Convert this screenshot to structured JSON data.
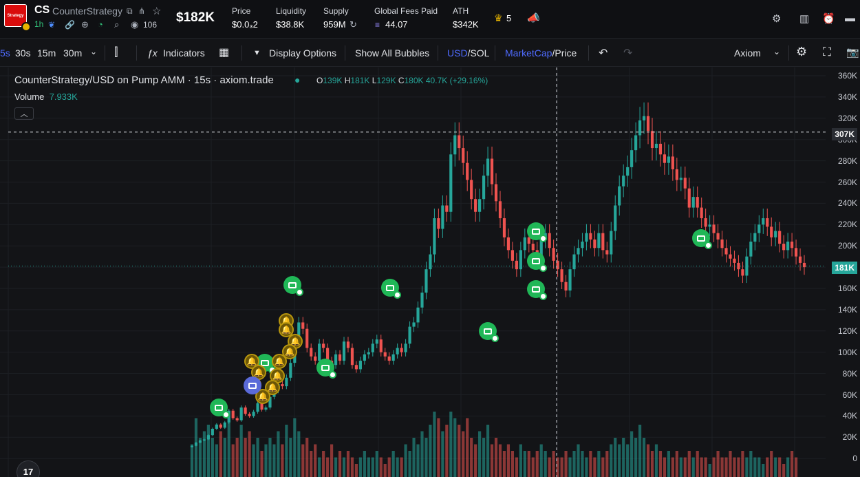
{
  "header": {
    "logo_text": "Strategy",
    "ticker": "CS",
    "name": "CounterStrategy",
    "timeframe": "1h",
    "watchers": "106",
    "market_cap": "$182K",
    "stats": [
      {
        "label": "Price",
        "value": "$0.0₃2"
      },
      {
        "label": "Liquidity",
        "value": "$38.8K"
      },
      {
        "label": "Supply",
        "value": "959M"
      },
      {
        "label": "Global Fees Paid",
        "value": "44.07"
      },
      {
        "label": "ATH",
        "value": "$342K"
      }
    ],
    "crown_count": "5"
  },
  "toolbar": {
    "intervals": [
      "5s",
      "30s",
      "15m",
      "30m"
    ],
    "indicators": "Indicators",
    "display_options": "Display Options",
    "show_bubbles": "Show All Bubbles",
    "usd": "USD",
    "sol": "SOL",
    "slash": "/",
    "marketcap": "MarketCap",
    "price": "Price",
    "layout": "Axiom"
  },
  "legend": {
    "title": "CounterStrategy/USD on Pump AMM · 15s · axiom.trade",
    "o_label": "O",
    "o": "139K",
    "h_label": "H",
    "h": "181K",
    "l_label": "L",
    "l": "129K",
    "c_label": "C",
    "c": "180K",
    "change": "40.7K (+29.16%)",
    "volume_label": "Volume",
    "volume": "7.933K"
  },
  "yaxis": {
    "labels": [
      "360K",
      "340K",
      "320K",
      "300K",
      "280K",
      "260K",
      "240K",
      "220K",
      "200K",
      "180K",
      "160K",
      "140K",
      "120K",
      "100K",
      "80K",
      "60K",
      "40K",
      "20K",
      "0"
    ],
    "crosshair": "307K",
    "last": "181K"
  },
  "colors": {
    "up": "#26a69a",
    "down": "#ef5350",
    "accent": "#4f6bff",
    "positive": "#32c27a"
  },
  "chart_data": {
    "type": "candlestick",
    "ylim": [
      0,
      360000
    ],
    "close": [
      12000,
      15000,
      17000,
      18000,
      22000,
      28000,
      32000,
      29000,
      34000,
      45000,
      38000,
      36000,
      48000,
      42000,
      40000,
      44000,
      52000,
      46000,
      48000,
      58000,
      64000,
      70000,
      68000,
      76000,
      90000,
      110000,
      128000,
      122000,
      104000,
      96000,
      92000,
      108000,
      104000,
      92000,
      88000,
      98000,
      92000,
      110000,
      104000,
      88000,
      84000,
      92000,
      98000,
      100000,
      108000,
      112000,
      100000,
      96000,
      92000,
      98000,
      104000,
      100000,
      108000,
      124000,
      128000,
      142000,
      156000,
      178000,
      192000,
      226000,
      216000,
      238000,
      232000,
      286000,
      304000,
      292000,
      278000,
      262000,
      244000,
      232000,
      244000,
      266000,
      282000,
      258000,
      242000,
      226000,
      208000,
      196000,
      186000,
      178000,
      196000,
      208000,
      202000,
      196000,
      188000,
      206000,
      212000,
      198000,
      186000,
      178000,
      166000,
      158000,
      178000,
      192000,
      198000,
      204000,
      212000,
      206000,
      198000,
      212000,
      196000,
      192000,
      214000,
      238000,
      256000,
      266000,
      274000,
      290000,
      304000,
      318000,
      322000,
      308000,
      292000,
      296000,
      286000,
      278000,
      284000,
      272000,
      262000,
      264000,
      254000,
      236000,
      246000,
      236000,
      226000,
      218000,
      220000,
      212000,
      206000,
      198000,
      192000,
      188000,
      184000,
      178000,
      172000,
      190000,
      204000,
      212000,
      220000,
      226000,
      218000,
      208000,
      214000,
      202000,
      196000,
      204000,
      198000,
      190000,
      184000,
      180000
    ],
    "volume": [
      0.5,
      0.9,
      0.6,
      0.7,
      0.8,
      0.6,
      0.5,
      0.7,
      0.6,
      0.9,
      0.5,
      0.6,
      0.8,
      0.6,
      0.7,
      0.5,
      0.6,
      0.4,
      0.5,
      0.6,
      0.5,
      0.7,
      0.5,
      0.8,
      0.6,
      0.9,
      0.7,
      0.5,
      0.6,
      0.4,
      0.5,
      0.3,
      0.4,
      0.3,
      0.5,
      0.3,
      0.4,
      0.3,
      0.4,
      0.3,
      0.2,
      0.3,
      0.4,
      0.3,
      0.3,
      0.4,
      0.3,
      0.2,
      0.3,
      0.4,
      0.3,
      0.3,
      0.5,
      0.4,
      0.6,
      0.5,
      0.7,
      0.6,
      0.8,
      1.0,
      0.9,
      0.7,
      0.8,
      1.0,
      0.9,
      0.8,
      0.7,
      0.9,
      0.6,
      0.5,
      0.7,
      0.6,
      0.8,
      0.5,
      0.6,
      0.5,
      0.4,
      0.5,
      0.4,
      0.3,
      0.5,
      0.4,
      0.4,
      0.3,
      0.4,
      0.5,
      0.4,
      0.3,
      0.4,
      0.3,
      0.3,
      0.4,
      0.3,
      0.4,
      0.5,
      0.4,
      0.3,
      0.4,
      0.3,
      0.4,
      0.3,
      0.4,
      0.5,
      0.6,
      0.5,
      0.6,
      0.5,
      0.7,
      0.6,
      0.8,
      0.6,
      0.5,
      0.4,
      0.5,
      0.4,
      0.3,
      0.4,
      0.3,
      0.4,
      0.3,
      0.3,
      0.4,
      0.3,
      0.4,
      0.3,
      0.3,
      0.2,
      0.3,
      0.4,
      0.3,
      0.3,
      0.4,
      0.3,
      0.3,
      0.4,
      0.3,
      0.4,
      0.3,
      0.3,
      0.2,
      0.3,
      0.4,
      0.3,
      0.3,
      0.2,
      0.3,
      0.4,
      0.3
    ]
  }
}
